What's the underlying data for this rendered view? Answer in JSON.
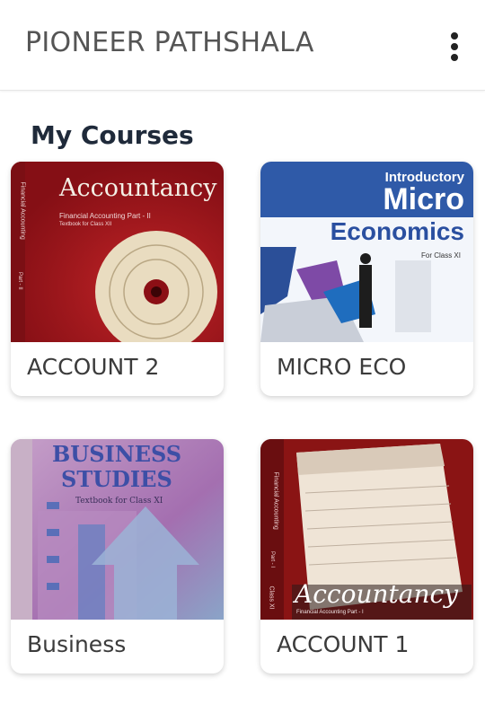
{
  "app": {
    "title": "PIONEER PATHSHALA",
    "menu_icon": "more-vertical-icon"
  },
  "section": {
    "title": "My Courses"
  },
  "courses": [
    {
      "label": "ACCOUNT 2",
      "cover": {
        "title": "Accountancy",
        "subtitle": "Financial Accounting Part - II",
        "subtitle2": "Textbook for Class XII",
        "spine": "Financial Accounting",
        "spine_part": "Part - II",
        "bg": "#b0141c"
      }
    },
    {
      "label": "MICRO ECO",
      "cover": {
        "title_line1": "Introductory",
        "title_line2": "Micro",
        "title_line3": "Economics",
        "subtitle": "For Class XI",
        "bg": "#2f5aa8"
      }
    },
    {
      "label": "Business",
      "cover": {
        "title_line1": "BUSINESS",
        "title_line2": "STUDIES",
        "subtitle": "Textbook for Class XI",
        "bg": "#b27bb0"
      }
    },
    {
      "label": "ACCOUNT 1",
      "cover": {
        "title": "Accountancy",
        "subtitle": "Financial Accounting   Part - I",
        "spine": "Financial Accounting",
        "spine_part": "Part - I",
        "spine_class": "Class XI",
        "bg": "#8a1414"
      }
    }
  ]
}
